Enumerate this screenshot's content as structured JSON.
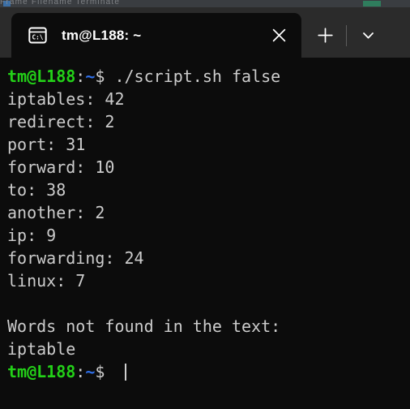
{
  "window": {
    "background_color": "#0c0c0c",
    "tabbar_color": "#2b2b2b"
  },
  "background_window": {
    "strip_text": "Frame        Filename        Terminate",
    "visible": true
  },
  "tabbar": {
    "tab": {
      "icon": "console-cmd-icon",
      "title": "tm@L188: ~",
      "close_label": "✕"
    },
    "new_tab_label": "+",
    "dropdown_label": "∨"
  },
  "terminal": {
    "prompt": {
      "user_host": "tm@L188",
      "colon": ":",
      "path": "~",
      "sigil": "$"
    },
    "command": " ./script.sh false",
    "colors": {
      "prompt_green": "#23d018",
      "path_blue": "#2f6fe8",
      "text": "#cccccc",
      "background": "#0c0c0c"
    },
    "word_counts": [
      {
        "word": "iptables",
        "count": "42"
      },
      {
        "word": "redirect",
        "count": "2"
      },
      {
        "word": "port",
        "count": "31"
      },
      {
        "word": "forward",
        "count": "10"
      },
      {
        "word": "to",
        "count": "38"
      },
      {
        "word": "another",
        "count": "2"
      },
      {
        "word": "ip",
        "count": "9"
      },
      {
        "word": "forwarding",
        "count": "24"
      },
      {
        "word": "linux",
        "count": "7"
      }
    ],
    "not_found_header": "Words not found in the text:",
    "not_found_words": [
      "iptable"
    ],
    "cursor_visible": true
  }
}
